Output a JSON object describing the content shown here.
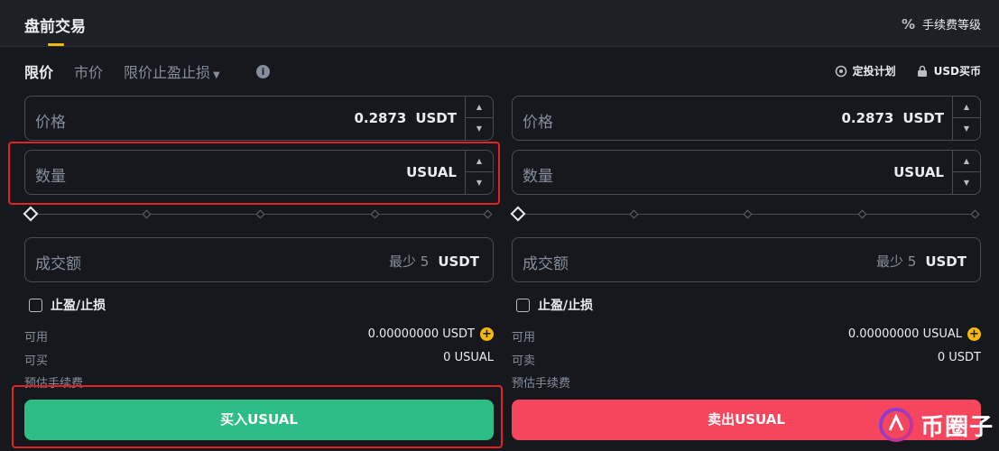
{
  "header": {
    "title": "盘前交易",
    "fee_level": "手续费等级"
  },
  "order_types": {
    "tabs": [
      "限价",
      "市价",
      "限价止盈止损"
    ],
    "active": "限价",
    "right_tools": [
      "定投计划",
      "USD买币"
    ]
  },
  "buy": {
    "price_label": "价格",
    "price_value": "0.2873",
    "price_unit": "USDT",
    "qty_label": "数量",
    "qty_unit": "USUAL",
    "total_label": "成交额",
    "total_min": "最少 5",
    "total_unit": "USDT",
    "tpsl_label": "止盈/止损",
    "available_label": "可用",
    "available_value": "0.00000000 USDT",
    "max_label": "可买",
    "max_value": "0 USUAL",
    "fee_label": "预估手续费",
    "action_label": "买入USUAL",
    "slider_percent": 0
  },
  "sell": {
    "price_label": "价格",
    "price_value": "0.2873",
    "price_unit": "USDT",
    "qty_label": "数量",
    "qty_unit": "USUAL",
    "total_label": "成交额",
    "total_min": "最少 5",
    "total_unit": "USDT",
    "tpsl_label": "止盈/止损",
    "available_label": "可用",
    "available_value": "0.00000000 USUAL",
    "max_label": "可卖",
    "max_value": "0 USDT",
    "fee_label": "预估手续费",
    "action_label": "卖出USUAL",
    "slider_percent": 0
  },
  "watermark": {
    "text": "币圈子"
  },
  "colors": {
    "accent": "#f0b90b",
    "buy": "#2ebd85",
    "sell": "#f6465d",
    "highlight": "#e02424"
  }
}
